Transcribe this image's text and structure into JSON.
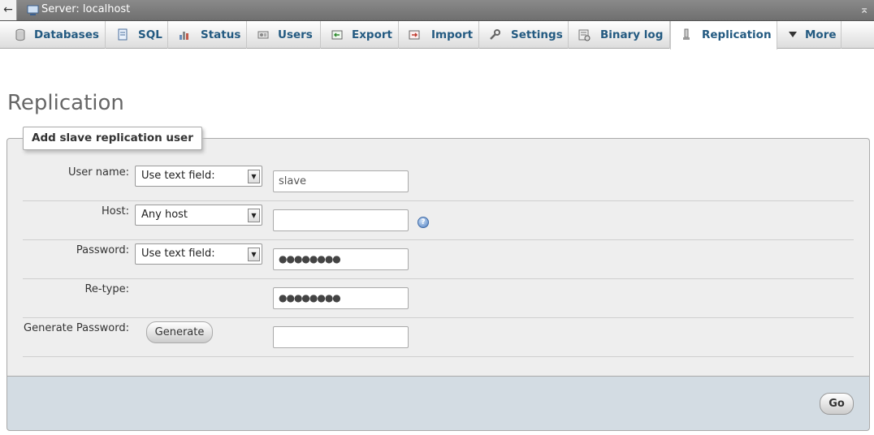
{
  "window": {
    "title": "Server: localhost"
  },
  "tabs": [
    {
      "id": "databases",
      "label": "Databases",
      "icon": "database-icon"
    },
    {
      "id": "sql",
      "label": "SQL",
      "icon": "sql-icon"
    },
    {
      "id": "status",
      "label": "Status",
      "icon": "status-chart-icon"
    },
    {
      "id": "users",
      "label": "Users",
      "icon": "users-icon"
    },
    {
      "id": "export",
      "label": "Export",
      "icon": "export-icon"
    },
    {
      "id": "import",
      "label": "Import",
      "icon": "import-icon"
    },
    {
      "id": "settings",
      "label": "Settings",
      "icon": "wrench-icon"
    },
    {
      "id": "binary_log",
      "label": "Binary log",
      "icon": "binary-log-icon"
    },
    {
      "id": "replication",
      "label": "Replication",
      "icon": "replication-icon",
      "active": true
    },
    {
      "id": "more",
      "label": "More",
      "icon": "triangle-down-icon"
    }
  ],
  "page": {
    "title": "Replication"
  },
  "form": {
    "legend": "Add slave replication user",
    "username": {
      "label": "User name:",
      "select": "Use text field:",
      "value": "slave"
    },
    "host": {
      "label": "Host:",
      "select": "Any host",
      "value": ""
    },
    "password": {
      "label": "Password:",
      "select": "Use text field:",
      "value": "●●●●●●●●"
    },
    "retype": {
      "label": "Re-type:",
      "value": "●●●●●●●●"
    },
    "generate": {
      "label": "Generate Password:",
      "button": "Generate",
      "value": ""
    },
    "submit": "Go"
  },
  "colors": {
    "accent": "#235a81",
    "footer": "#d3dce3",
    "panel": "#eeeeee"
  }
}
